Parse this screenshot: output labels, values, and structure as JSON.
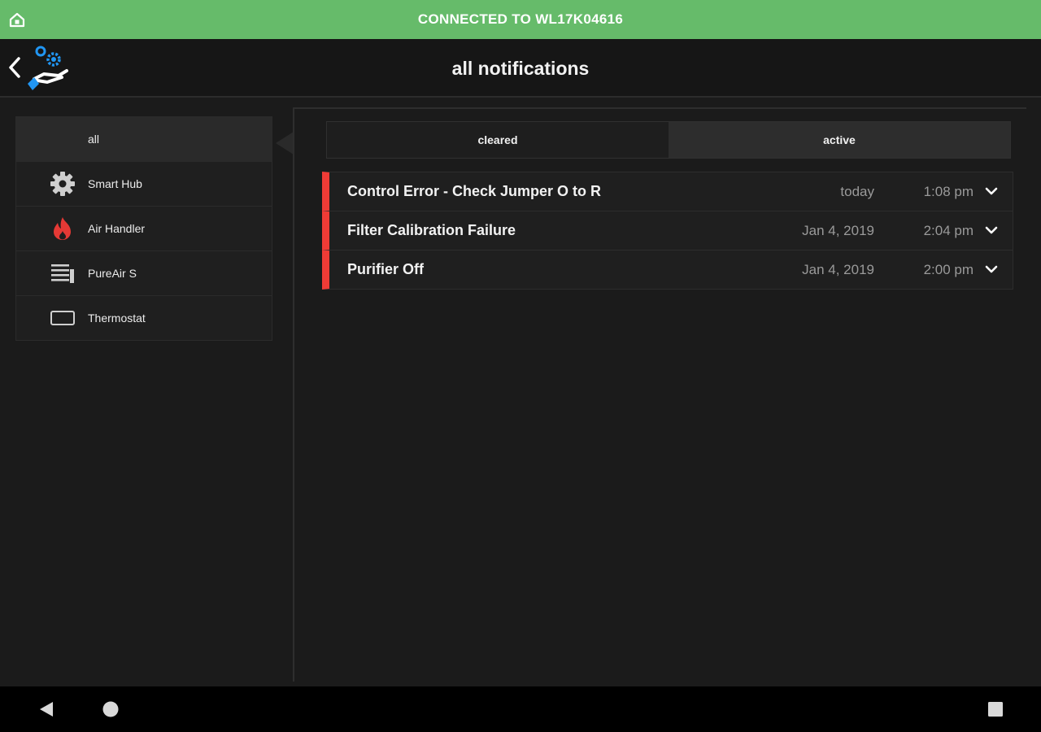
{
  "status_bar": {
    "text": "CONNECTED TO WL17K04616",
    "color": "#66bb6a"
  },
  "header": {
    "title": "all notifications"
  },
  "sidebar": {
    "items": [
      {
        "label": "all",
        "icon": "none",
        "selected": true
      },
      {
        "label": "Smart Hub",
        "icon": "gear-icon"
      },
      {
        "label": "Air Handler",
        "icon": "flame-icon",
        "icon_color": "#e53935"
      },
      {
        "label": "PureAir S",
        "icon": "purifier-icon"
      },
      {
        "label": "Thermostat",
        "icon": "thermostat-icon"
      }
    ]
  },
  "tabs": [
    {
      "label": "cleared",
      "selected": false
    },
    {
      "label": "active",
      "selected": true
    }
  ],
  "notifications": [
    {
      "title": "Control Error - Check Jumper O to R",
      "date": "today",
      "time": "1:08 pm"
    },
    {
      "title": "Filter Calibration Failure",
      "date": "Jan 4, 2019",
      "time": "2:04 pm"
    },
    {
      "title": "Purifier Off",
      "date": "Jan 4, 2019",
      "time": "2:00 pm"
    }
  ],
  "colors": {
    "alert": "#ef3b36",
    "accent_blue": "#2196f3",
    "background": "#1b1b1b"
  }
}
